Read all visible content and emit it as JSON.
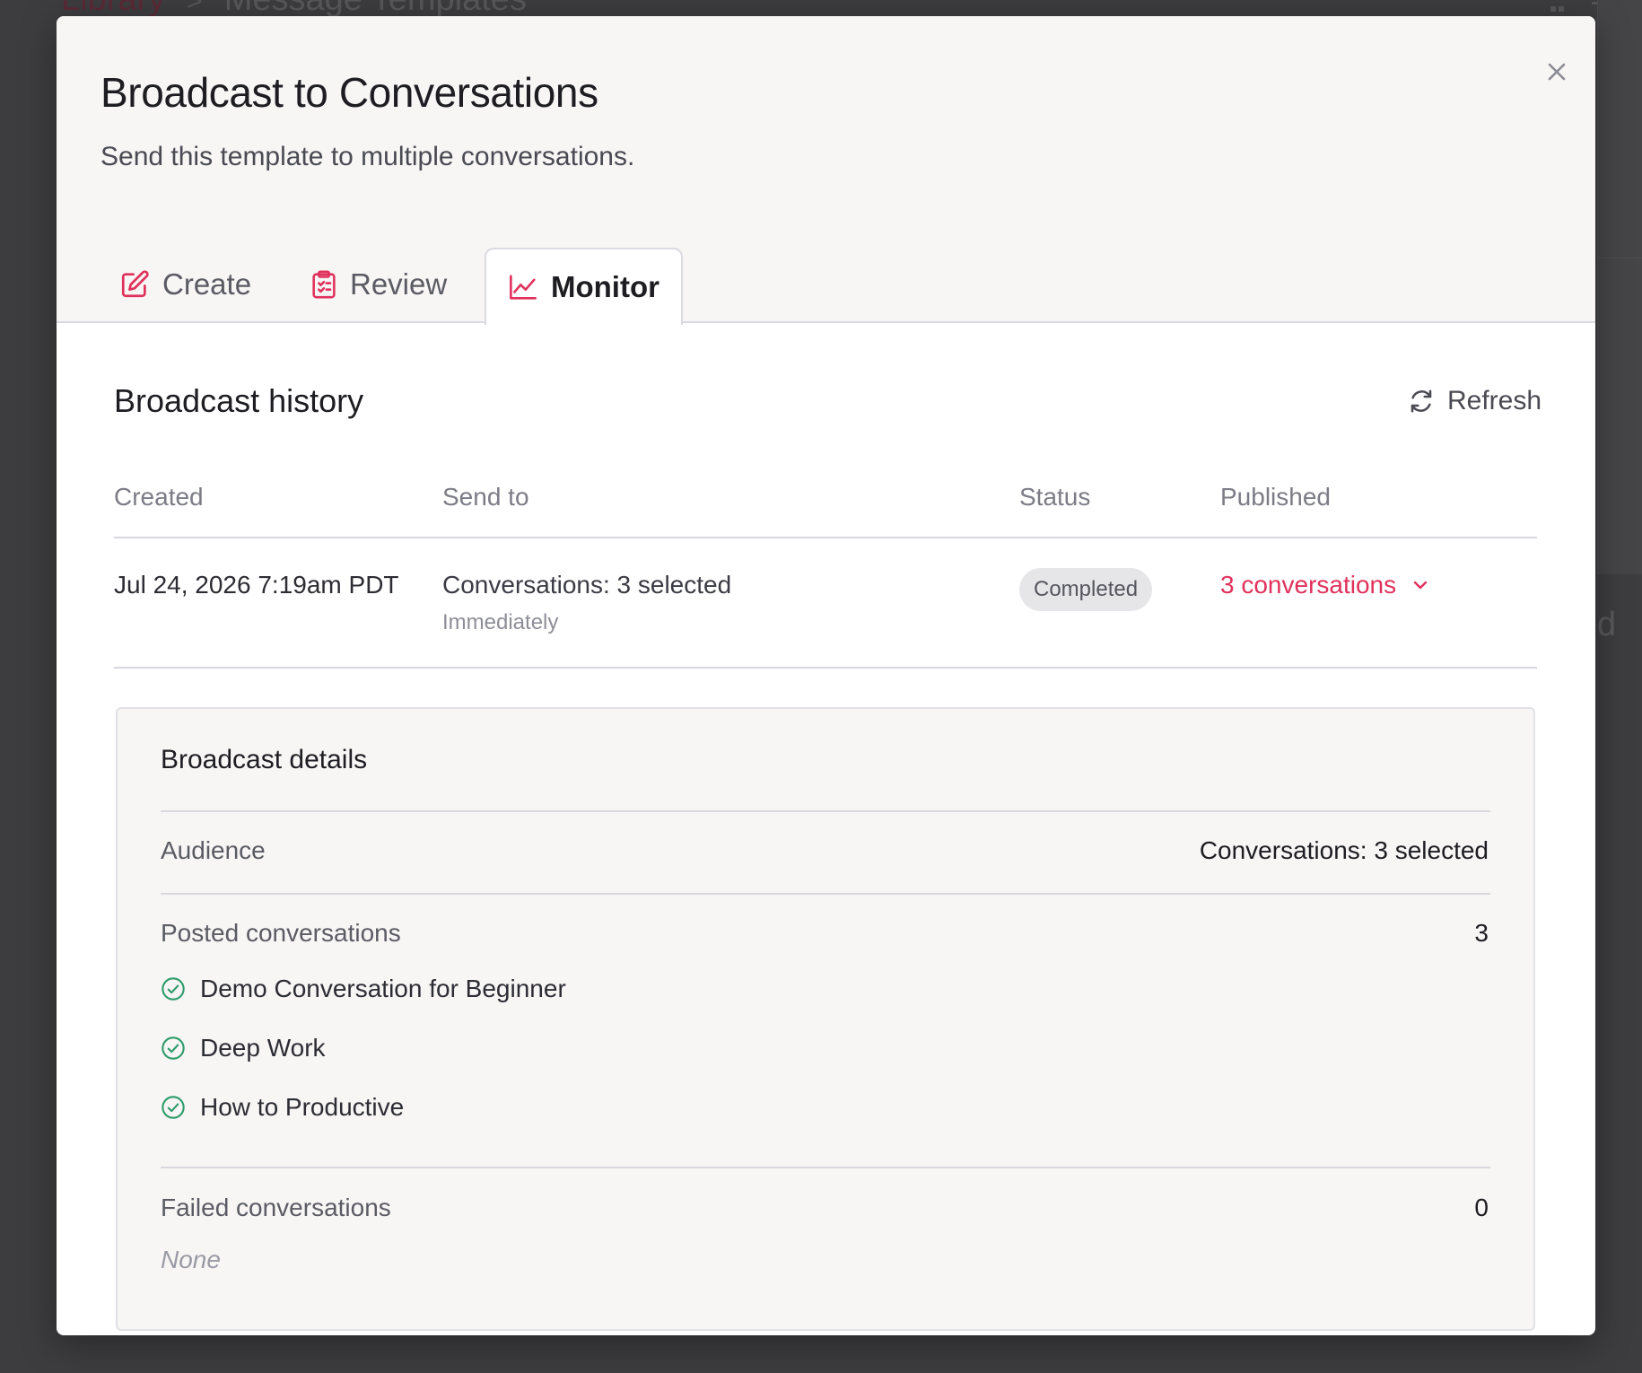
{
  "background": {
    "breadcrumb": {
      "root": "Library",
      "separator": ">",
      "current": "Message Templates"
    },
    "partial_text": "d"
  },
  "modal": {
    "title": "Broadcast to Conversations",
    "subtitle": "Send this template to multiple conversations.",
    "close_icon": "close-icon",
    "tabs": [
      {
        "label": "Create",
        "icon": "edit-icon",
        "active": false
      },
      {
        "label": "Review",
        "icon": "clipboard-icon",
        "active": false
      },
      {
        "label": "Monitor",
        "icon": "chart-line-icon",
        "active": true
      }
    ]
  },
  "history": {
    "title": "Broadcast history",
    "refresh_label": "Refresh",
    "columns": [
      "Created",
      "Send to",
      "Status",
      "Published"
    ],
    "rows": [
      {
        "created": "Jul 24, 2026 7:19am PDT",
        "send_to": "Conversations: 3 selected",
        "send_timing": "Immediately",
        "status": "Completed",
        "published": "3 conversations"
      }
    ]
  },
  "details": {
    "title": "Broadcast details",
    "audience_label": "Audience",
    "audience_value": "Conversations: 3 selected",
    "posted_label": "Posted conversations",
    "posted_count": "3",
    "posted_items": [
      "Demo Conversation for Beginner",
      "Deep Work",
      "How to Productive"
    ],
    "failed_label": "Failed conversations",
    "failed_count": "0",
    "failed_none": "None"
  },
  "colors": {
    "accent": "#e0315c",
    "success": "#2e9b6a",
    "header_bg": "#f7f6f5",
    "overlay": "#3d3d40"
  }
}
